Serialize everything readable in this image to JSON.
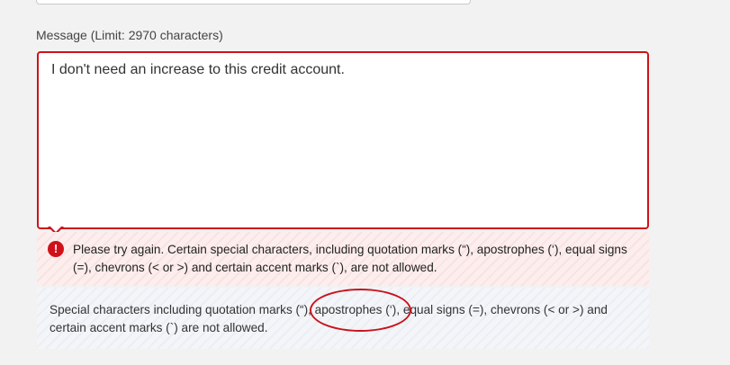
{
  "message_field": {
    "label": "Message (Limit: 2970 characters)",
    "value": "I don't need an increase to this credit account."
  },
  "error": {
    "icon": "error-exclamation-icon",
    "text": "Please try again. Certain special characters, including quotation marks (“), apostrophes (‘), equal signs (=), chevrons (< or >) and certain accent marks (`), are not allowed."
  },
  "info": {
    "text": "Special characters including quotation marks (“), apostrophes (‘), equal signs (=), chevrons (< or >) and certain accent marks (`) are not allowed."
  },
  "colors": {
    "error_red": "#d0111a",
    "error_background": "#fdeeee",
    "info_background": "#f3f5f8",
    "page_background": "#f2f2f2"
  }
}
